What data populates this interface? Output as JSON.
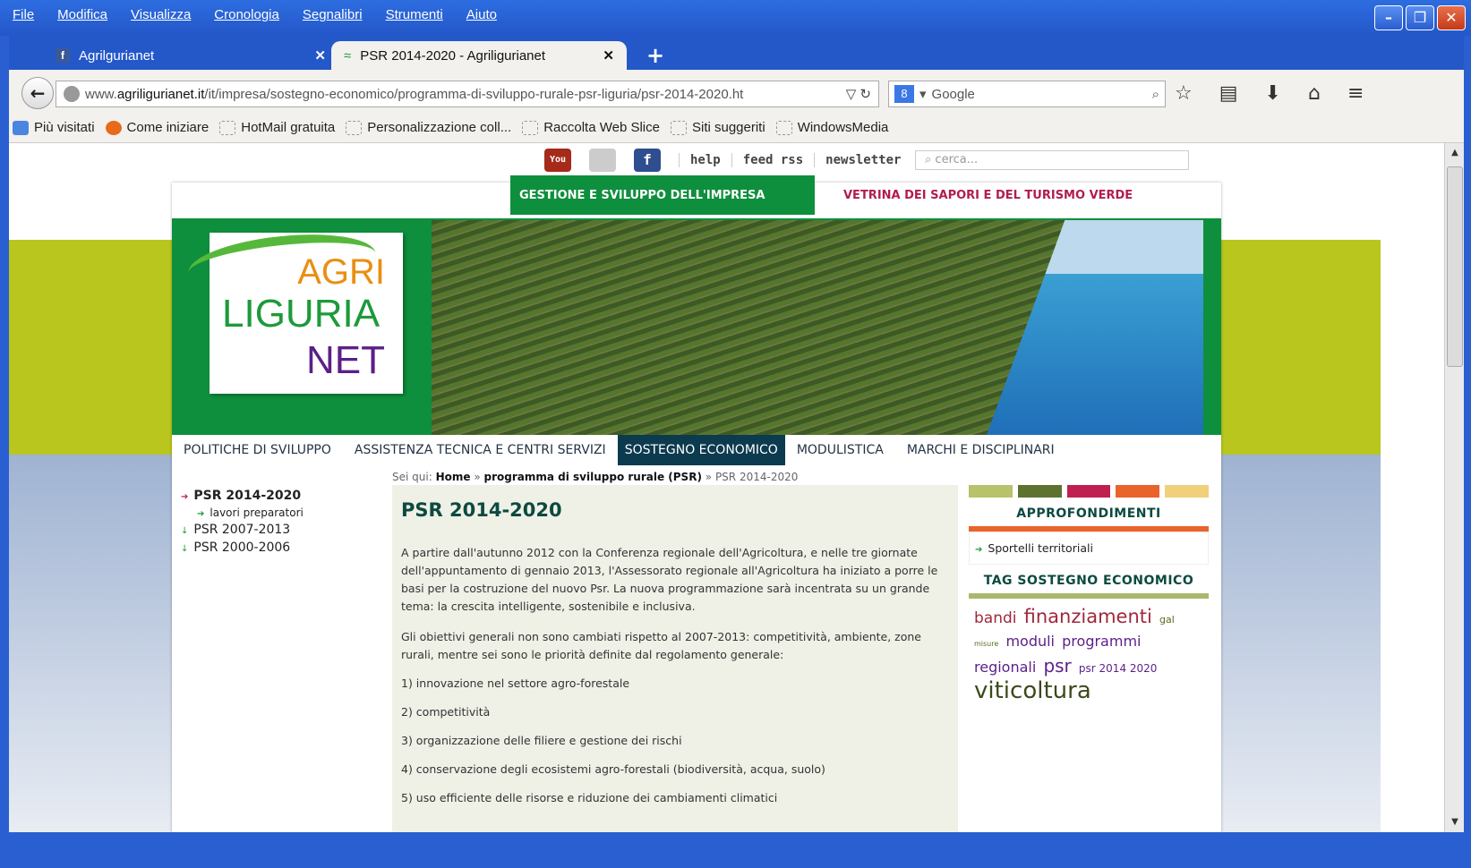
{
  "menu": [
    "File",
    "Modifica",
    "Visualizza",
    "Cronologia",
    "Segnalibri",
    "Strumenti",
    "Aiuto"
  ],
  "tabs": [
    {
      "label": "Agrilgurianet",
      "icon": "facebook-icon"
    },
    {
      "label": "PSR 2014-2020 - Agriligurianet",
      "icon": "site-icon"
    }
  ],
  "url": {
    "prefix": "www.",
    "host": "agriligurianet.it",
    "path": "/it/impresa/sostegno-economico/programma-di-sviluppo-rurale-psr-liguria/psr-2014-2020.ht"
  },
  "search": {
    "engine": "Google"
  },
  "bookmarks": [
    "Più visitati",
    "Come iniziare",
    "HotMail gratuita",
    "Personalizzazione coll...",
    "Raccolta Web Slice",
    "Siti suggeriti",
    "WindowsMedia"
  ],
  "toplinks": [
    "help",
    "feed rss",
    "newsletter"
  ],
  "search_site": {
    "placeholder": "cerca..."
  },
  "site_tabs": [
    "GESTIONE E SVILUPPO DELL'IMPRESA",
    "VETRINA DEI SAPORI E DEL TURISMO VERDE"
  ],
  "logo": {
    "line1": "AGRI",
    "line2": "LIGURIA",
    "line3": "NET"
  },
  "mainnav": [
    "POLITICHE DI SVILUPPO",
    "ASSISTENZA TECNICA E CENTRI SERVIZI",
    "SOSTEGNO ECONOMICO",
    "MODULISTICA",
    "MARCHI E DISCIPLINARI"
  ],
  "breadcrumb": {
    "prefix": "Sei qui:",
    "home": "Home",
    "sep": "»",
    "psr": "programma di sviluppo rurale (PSR)",
    "current": "PSR 2014-2020"
  },
  "leftnav": {
    "active": "PSR 2014-2020",
    "sub": "lavori preparatori",
    "items": [
      "PSR 2007-2013",
      "PSR 2000-2006"
    ]
  },
  "content": {
    "title": "PSR 2014-2020",
    "p1": "A partire dall'autunno 2012 con la Conferenza regionale dell'Agricoltura, e nelle tre giornate dell'appuntamento di gennaio 2013, l'Assessorato regionale all'Agricoltura ha iniziato a porre le basi per la costruzione del nuovo Psr. La nuova programmazione sarà incentrata su un grande tema: la crescita intelligente, sostenibile e inclusiva.",
    "p2": "Gli obiettivi generali non sono cambiati rispetto al 2007-2013: competitività, ambiente, zone rurali, mentre sei sono le priorità definite dal regolamento generale:",
    "items": [
      "1) innovazione nel settore agro-forestale",
      "2) competitività",
      "3) organizzazione delle filiere e gestione dei rischi",
      "4) conservazione degli ecosistemi agro-forestali (biodiversità, acqua, suolo)",
      "5) uso efficiente delle risorse e riduzione dei cambiamenti climatici"
    ]
  },
  "sidebar": {
    "approfondimenti": "APPROFONDIMENTI",
    "link": "Sportelli territoriali",
    "tag_title": "TAG SOSTEGNO ECONOMICO",
    "tags": [
      {
        "t": "bandi",
        "c": "#a0283c"
      },
      {
        "t": "finanziamenti",
        "c": "#a0283c"
      },
      {
        "t": "gal",
        "c": "#5a6a1e"
      },
      {
        "t": "misure",
        "c": "#5a6a1e"
      },
      {
        "t": "moduli",
        "c": "#5b1f8a"
      },
      {
        "t": "programmi",
        "c": "#5b1f8a"
      },
      {
        "t": "regionali",
        "c": "#5b1f8a"
      },
      {
        "t": "psr",
        "c": "#5b1f8a"
      },
      {
        "t": "psr 2014 2020",
        "c": "#5b1f8a"
      },
      {
        "t": "viticoltura",
        "c": "#3c4a1a"
      }
    ],
    "swatches": [
      "#b7c26b",
      "#5e7230",
      "#c02050",
      "#e8642a",
      "#f0d07a"
    ]
  }
}
